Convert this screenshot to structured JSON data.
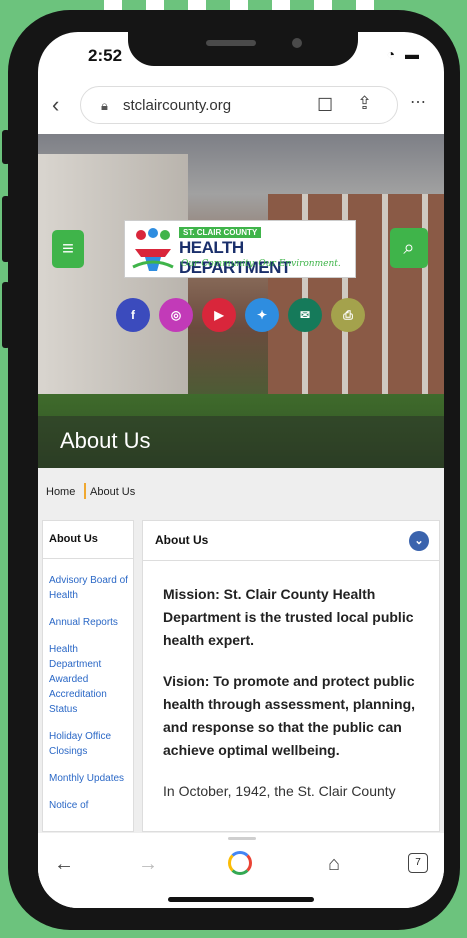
{
  "status_bar": {
    "time": "2:52",
    "icons": [
      "signal-icon",
      "wifi-icon",
      "battery-icon"
    ]
  },
  "browser": {
    "url": "stclaircounty.org",
    "icons": [
      "back-chevron-icon",
      "lock-icon",
      "bookmark-icon",
      "share-icon",
      "more-icon"
    ]
  },
  "header": {
    "logo_top": "ST. CLAIR COUNTY",
    "logo_main": "HEALTH DEPARTMENT",
    "logo_tagline": "Our Community. Our Environment.",
    "menu_icon": "hamburger-icon",
    "search_icon": "search-icon"
  },
  "social": [
    {
      "name": "facebook",
      "color": "#3b4bbd"
    },
    {
      "name": "instagram",
      "color": "#c23ab8"
    },
    {
      "name": "youtube",
      "color": "#d9263b"
    },
    {
      "name": "twitter",
      "color": "#2e8de0"
    },
    {
      "name": "email",
      "color": "#157a5a"
    },
    {
      "name": "print",
      "color": "#a4a24c"
    }
  ],
  "page_title": "About Us",
  "breadcrumb": {
    "home": "Home",
    "current": "About Us"
  },
  "sidebar": {
    "heading": "About Us",
    "links": [
      "Advisory Board of Health",
      "Annual Reports",
      "Health Department Awarded Accreditation Status",
      "Holiday Office Closings",
      "Monthly Updates",
      "Notice of"
    ]
  },
  "main": {
    "heading": "About Us",
    "mission": "Mission: St. Clair County Health Department is the trusted local public health expert.",
    "vision": "Vision: To promote and protect public health through assessment, planning, and response so that the public can achieve optimal wellbeing.",
    "intro": "In October, 1942, the St. Clair County"
  },
  "bottom_nav": {
    "tabs_count": "7"
  },
  "colors": {
    "brand_green": "#3fb44a",
    "link_blue": "#2b68c6",
    "accent_blue": "#3a63ad",
    "breadcrumb_accent": "#f0a830"
  }
}
